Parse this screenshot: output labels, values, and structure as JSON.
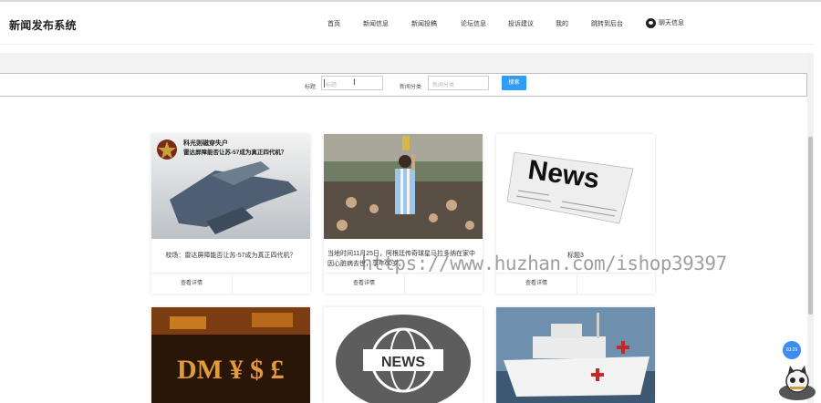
{
  "header": {
    "title": "新闻发布系统",
    "nav": [
      "首页",
      "新闻信息",
      "新闻投稿",
      "论坛信息",
      "投诉建议",
      "我的",
      "跳转到后台"
    ],
    "chat_label": "聊天信息",
    "chat_icon": "chat-bubble-icon"
  },
  "search": {
    "title_label": "标题",
    "title_placeholder": "标题",
    "category_label": "新闻分类",
    "category_placeholder": "新闻分类",
    "button_label": "搜索"
  },
  "cards": [
    {
      "title": "校场：雷达屏障能否让苏-57成为真正四代机？",
      "button": "查看详情",
      "image_caption_line1": "科光则磁穿失户",
      "image_caption_line2": "雷达屏障能否让苏-57成为真正四代机？"
    },
    {
      "title": "当地时间11月25日，阿根廷传奇球星马拉多纳在家中因心脏病去世，享年60岁。",
      "button": "查看详情"
    },
    {
      "title": "标题3",
      "button": "查看详情",
      "image_caption": "News"
    },
    {
      "title": "",
      "button": "",
      "image_caption": "DM ¥ $ £"
    },
    {
      "title": "",
      "button": "",
      "image_caption": "NEWS"
    },
    {
      "title": "",
      "button": ""
    }
  ],
  "float_badge": "03:29",
  "watermark": "https://www.huzhan.com/ishop39397"
}
